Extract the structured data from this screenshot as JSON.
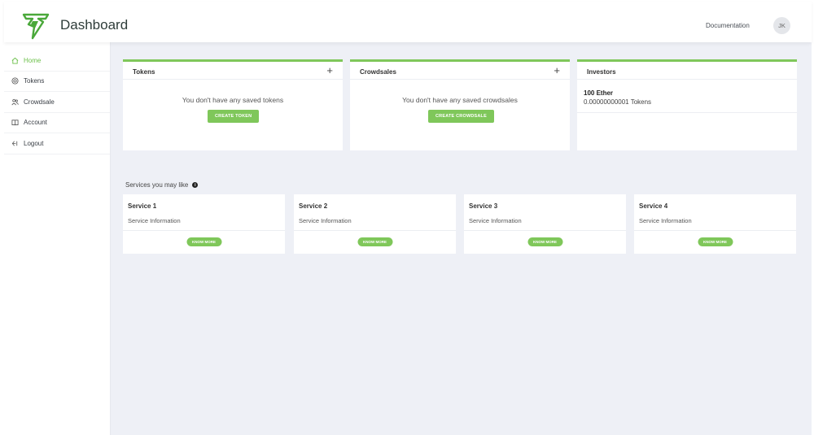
{
  "header": {
    "title": "Dashboard",
    "documentation_label": "Documentation",
    "avatar_initials": "JK",
    "logo_icon": "lightning-bolt-logo"
  },
  "sidebar": {
    "items": [
      {
        "label": "Home",
        "icon": "home-icon",
        "active": true
      },
      {
        "label": "Tokens",
        "icon": "token-icon",
        "active": false
      },
      {
        "label": "Crowdsale",
        "icon": "users-icon",
        "active": false
      },
      {
        "label": "Account",
        "icon": "book-icon",
        "active": false
      },
      {
        "label": "Logout",
        "icon": "logout-icon",
        "active": false
      }
    ]
  },
  "cards": {
    "tokens": {
      "title": "Tokens",
      "empty_message": "You don't have any saved tokens",
      "button_label": "CREATE TOKEN"
    },
    "crowdsales": {
      "title": "Crowdsales",
      "empty_message": "You don't have any saved crowdsales",
      "button_label": "CREATE CROWDSALE"
    },
    "investors": {
      "title": "Investors",
      "amount": "100 Ether",
      "tokens": "0.00000000001 Tokens"
    }
  },
  "services": {
    "title": "Services you may like",
    "items": [
      {
        "name": "Service 1",
        "info": "Service Information",
        "button_label": "KNOW MORE"
      },
      {
        "name": "Service 2",
        "info": "Service Information",
        "button_label": "KNOW MORE"
      },
      {
        "name": "Service 3",
        "info": "Service Information",
        "button_label": "KNOW MORE"
      },
      {
        "name": "Service 4",
        "info": "Service Information",
        "button_label": "KNOW MORE"
      }
    ]
  },
  "colors": {
    "accent": "#7fc75a",
    "active_nav": "#6cc04a",
    "main_background": "#eef0f6"
  }
}
